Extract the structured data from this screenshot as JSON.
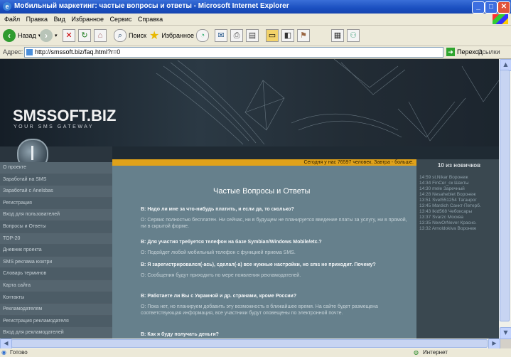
{
  "window": {
    "title": "Мобильный маркетинг: частые вопросы и ответы - Microsoft Internet Explorer",
    "buttons": {
      "minimize": "_",
      "maximize": "□",
      "close": "✕"
    }
  },
  "menu": [
    "Файл",
    "Правка",
    "Вид",
    "Избранное",
    "Сервис",
    "Справка"
  ],
  "toolbar": {
    "back_label": "Назад",
    "search_label": "Поиск",
    "favorites_label": "Избранное"
  },
  "address": {
    "label": "Адрес:",
    "value": "http://smssoft.biz/faq.html?r=0",
    "go_label": "Переход",
    "links_label": "Ссылки"
  },
  "site": {
    "logo": "SMSSOFT.BIZ",
    "tagline": "YOUR SMS GATEWAY",
    "stats_strip": "Сегодня у нас 76597 человек. Завтра - больше.",
    "nav": [
      "О проекте",
      "Заработай на SMS",
      "Заработай с Anelsbas",
      "Регистрация",
      "Вход для пользователей",
      "Вопросы и Ответы",
      "TOP-20",
      "Дневник проекта",
      "SMS реклама юзктри",
      "Словарь терминов",
      "Карта сайта",
      "Контакты",
      "Рекламодателям",
      "Регистрация рекламодателя",
      "Вход для рекламодателей"
    ],
    "faq_title": "Частые Вопросы и Ответы",
    "faq": [
      {
        "q": "В: Надо ли мне за что-нибудь платить, и если да, то сколько?",
        "a": "О: Сервис полностью бесплатен. Ни сейчас, ни в будущем не планируется введение платы за услугу, ни в прямой, ни в скрытой форме."
      },
      {
        "q": "В: Для участия требуется телефон на базе Symbian/Windows Mobile/etc.?",
        "a": "О: Подойдет любой мобильный телефон с функцией приема SMS."
      },
      {
        "q": "В: Я зарегистрировался(-ась), сделал(-а) все нужные настройки, но sms не приходит. Почему?",
        "a": "О: Сообщения будут приходить по мере появления рекламодателей."
      },
      {
        "q": "В: Работаете ли Вы с Украиной и др. странами, кроме России?",
        "a": "О: Пока нет, но планируем добавить эту возможность в ближайшее время. На сайте будет размещена соответствующая информация, все участники будут оповещены по электронной почте."
      },
      {
        "q": "В: Как я буду получать деньги?",
        "a": ""
      }
    ],
    "news_title": "10 из новичков",
    "news": [
      "14:59 st.Nikar Воронеж",
      "14:34 FinCer_ск Шахты",
      "14:30 mele Заречный",
      "14:28 Nesaheblet Воронеж",
      "13:51 Svet551254 Таганрог",
      "13:45 Mardich Санкт-Петерб.",
      "13:43 Ikid568 Чебоксары",
      "13:37 Svarzc Москва",
      "13:35 NewOrNever Красно.",
      "13:32 Arnoldokiva Воронеж"
    ]
  },
  "status": {
    "left": "Готово",
    "right": "Интернет"
  },
  "colors": {
    "titlebar": "#1a4fc0",
    "accent_strip": "#e0a21a",
    "content_bg": "#66808c",
    "sidebar_bg": "#55656f"
  }
}
